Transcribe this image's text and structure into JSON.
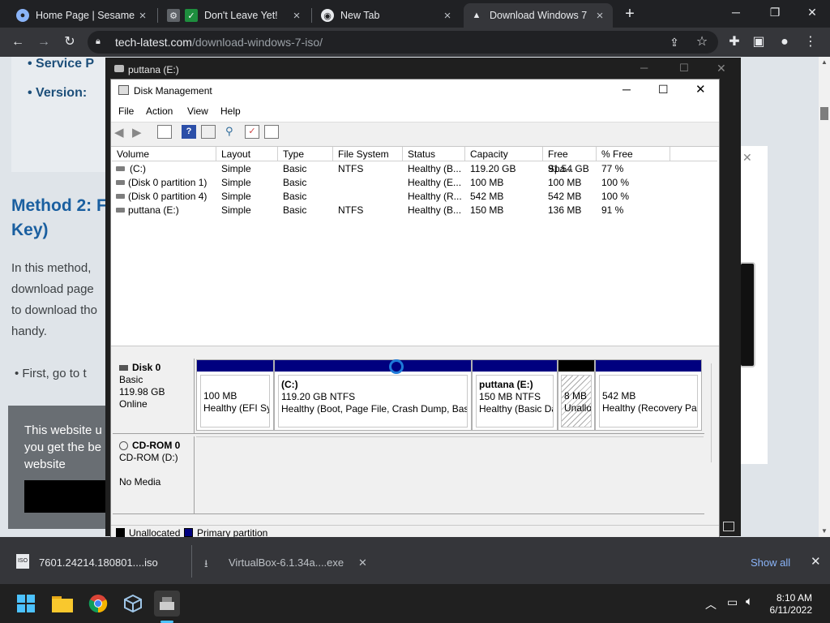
{
  "browser": {
    "tabs": [
      {
        "title": "Home Page | Sesame S"
      },
      {
        "title": "Don't Leave Yet!"
      },
      {
        "title": "New Tab"
      },
      {
        "title": "Download Windows 7"
      }
    ],
    "new_tab_glyph": "+",
    "address_domain": "tech-latest.com",
    "address_path": "/download-windows-7-iso/"
  },
  "webpage": {
    "bullet1": "Service P",
    "bullet2": "Version: ",
    "heading_line1": "Method 2: F",
    "heading_line2": "Key)",
    "para1": "In this method,",
    "para2": "download page",
    "para3": "to download tho",
    "para4": "handy.",
    "bullet3": "First, go to t",
    "cookie_line1": "This website u",
    "cookie_line2": "you get the be",
    "cookie_line3": "website"
  },
  "puttana_window": {
    "title": "puttana (E:)"
  },
  "disk_management": {
    "title": "Disk Management",
    "menu": [
      "File",
      "Action",
      "View",
      "Help"
    ],
    "columns": [
      "Volume",
      "Layout",
      "Type",
      "File System",
      "Status",
      "Capacity",
      "Free Spa...",
      "% Free"
    ],
    "rows": [
      [
        "(C:)",
        "Simple",
        "Basic",
        "NTFS",
        "Healthy (B...",
        "119.20 GB",
        "91.54 GB",
        "77 %"
      ],
      [
        "(Disk 0 partition 1)",
        "Simple",
        "Basic",
        "",
        "Healthy (E...",
        "100 MB",
        "100 MB",
        "100 %"
      ],
      [
        "(Disk 0 partition 4)",
        "Simple",
        "Basic",
        "",
        "Healthy (R...",
        "542 MB",
        "542 MB",
        "100 %"
      ],
      [
        "puttana (E:)",
        "Simple",
        "Basic",
        "NTFS",
        "Healthy (B...",
        "150 MB",
        "136 MB",
        "91 %"
      ]
    ],
    "disk0": {
      "name": "Disk 0",
      "type": "Basic",
      "size": "119.98 GB",
      "state": "Online",
      "partitions": [
        {
          "name": "",
          "size": "100 MB",
          "status": "Healthy (EFI Sys"
        },
        {
          "name": "(C:)",
          "size": "119.20 GB NTFS",
          "status": "Healthy (Boot, Page File, Crash Dump, Basic"
        },
        {
          "name": "puttana  (E:)",
          "size": "150 MB NTFS",
          "status": "Healthy (Basic Da"
        },
        {
          "name": "",
          "size": "8 MB",
          "status": "Unallo"
        },
        {
          "name": "",
          "size": "542 MB",
          "status": "Healthy (Recovery Par"
        }
      ]
    },
    "cdrom0": {
      "name": "CD-ROM 0",
      "drive": "CD-ROM (D:)",
      "media": "No Media"
    },
    "legend": [
      "Unallocated",
      "Primary partition"
    ],
    "colors": {
      "primary": "#00007f",
      "unallocated": "#000000"
    }
  },
  "downloads": {
    "item1": "7601.24214.180801....iso",
    "item2": "VirtualBox-6.1.34a....exe",
    "show_all": "Show all"
  },
  "taskbar": {
    "time": "8:10 AM",
    "date": "6/11/2022"
  }
}
